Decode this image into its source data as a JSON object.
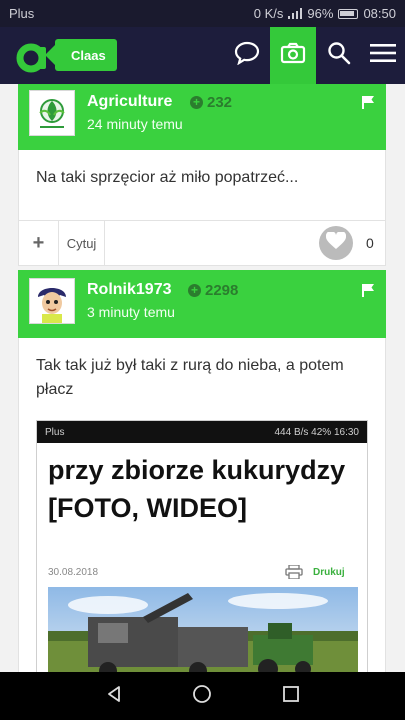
{
  "status_bar": {
    "carrier": "Plus",
    "speed": "0 K/s",
    "battery": "96%",
    "time": "08:50"
  },
  "app_bar": {
    "group_tag": "Claas"
  },
  "posts": [
    {
      "author": "Agriculture",
      "points": "232",
      "time": "24 minuty temu",
      "text": "Na taki sprzęcior aż miło popatrzeć...",
      "actions": {
        "quote_label": "Cytuj",
        "likes": "0"
      }
    },
    {
      "author": "Rolnik1973",
      "points": "2298",
      "time": "3 minuty temu",
      "text": "Tak tak już był taki z rurą do nieba, a potem płacz",
      "embedded_screenshot": {
        "carrier": "Plus",
        "status_right": "444 B/s 42% 16:30",
        "headline": "przy zbiorze kukurydzy [FOTO, WIDEO]",
        "date": "30.08.2018",
        "print_label": "Drukuj"
      }
    }
  ],
  "colors": {
    "accent": "#3ad13f",
    "appbar": "#1d1d3c",
    "points": "#2b7d2e"
  }
}
